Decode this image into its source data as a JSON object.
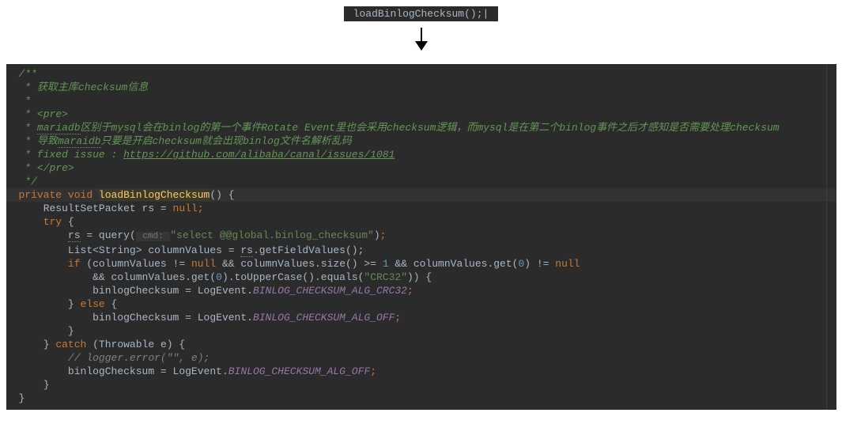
{
  "top": {
    "call": "loadBinlogChecksum();"
  },
  "code": {
    "doc": {
      "open": "/**",
      "star": " *",
      "title": " * 获取主库checksum信息",
      "pre_open": "<pre>",
      "line1a": "mariadb",
      "line1b": "区别于mysql会在binlog的第一个事件Rotate Event里也会采用checksum逻辑，而mysql是在第二个binlog事件之后才感知是否需要处理checksum",
      "line2a": "maraidb",
      "line2b": "导致",
      "line2c": "只要是开启checksum就会出现binlog文件名解析乱码",
      "fixed": " * fixed issue : ",
      "link": "https://github.com/alibaba/canal/issues/1081",
      "pre_close": "</pre>",
      "close": " */"
    },
    "method": {
      "modifiers": "private void ",
      "name": "loadBinlogChecksum",
      "paren": "() {"
    },
    "body": {
      "l1": "    ResultSetPacket rs = ",
      "l1b": "null",
      "l2": "    try",
      "l3a": "        ",
      "l3b": "rs",
      "l3c": " = query(",
      "l3hint": " cmd: ",
      "l3d": "\"select @@global.binlog_checksum\"",
      "l4a": "        List<String> columnValues = ",
      "l4b": "rs",
      "l4c": ".getFieldValues();",
      "l5a": "        if",
      "l5b": " (columnValues != ",
      "l5c": "null",
      "l5d": " && columnValues.size() >= ",
      "l5e": "1",
      "l5f": " && columnValues.get(",
      "l5g": "0",
      "l5h": ") != ",
      "l5i": "null",
      "l6a": "            && columnValues.get(",
      "l6b": "0",
      "l6c": ").toUpperCase().equals(",
      "l6d": "\"CRC32\"",
      "l6e": ")) {",
      "l7a": "            binlogChecksum = LogEvent.",
      "l7b": "BINLOG_CHECKSUM_ALG_CRC32",
      "l8a": "        } ",
      "l8b": "else",
      "l8c": " {",
      "l9a": "            binlogChecksum = LogEvent.",
      "l9b": "BINLOG_CHECKSUM_ALG_OFF",
      "l10": "        }",
      "l11a": "    } ",
      "l11b": "catch",
      "l11c": " (Throwable e) {",
      "l12": "        // logger.error(\"\", e);",
      "l13a": "        binlogChecksum = LogEvent.",
      "l13b": "BINLOG_CHECKSUM_ALG_OFF",
      "l14": "    }",
      "l15": "}"
    }
  }
}
